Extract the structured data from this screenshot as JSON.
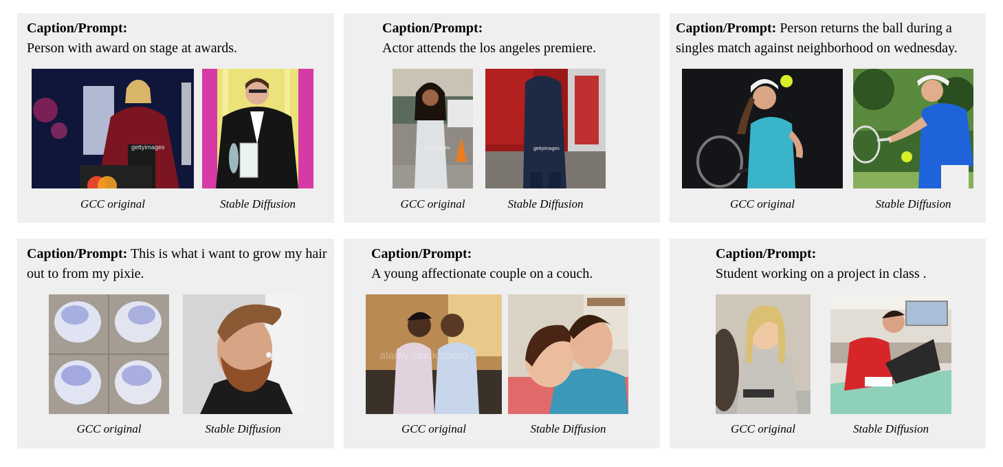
{
  "prefix": "Caption/Prompt:",
  "label_original": "GCC original",
  "label_generated": "Stable Diffusion",
  "panels": [
    {
      "caption": "Person with award on stage at awards.",
      "watermark_original": "gettyimages"
    },
    {
      "caption": "Actor attends the los angeles premiere.",
      "watermark_original": "gettyimages",
      "watermark_generated": "gettyimages"
    },
    {
      "caption": "Person returns the ball during a singles match against neighborhood on wednesday."
    },
    {
      "caption": "This is what i want to grow my hair out to from my pixie."
    },
    {
      "caption": "A young affectionate couple on a couch.",
      "watermark_original": "alamy stock photo"
    },
    {
      "caption": "Student working on a project in class ."
    }
  ]
}
